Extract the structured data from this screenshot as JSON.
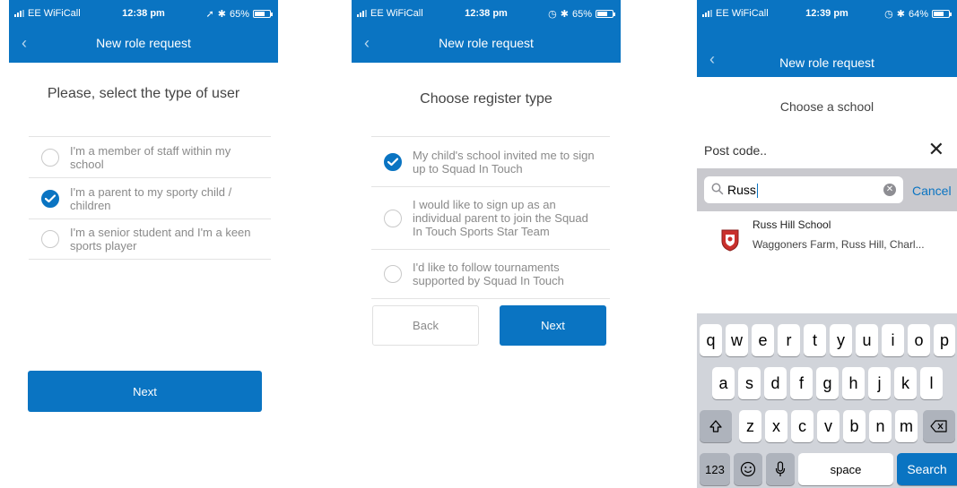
{
  "colors": {
    "primary": "#0a74c2",
    "keyboard_bg": "#d1d4da",
    "search_bar_bg": "#c9c9ce"
  },
  "phone1": {
    "status": {
      "carrier": "EE WiFiCall",
      "time": "12:38 pm",
      "battery": "65%"
    },
    "nav_title": "New role request",
    "heading": "Please, select the type of user",
    "options": [
      {
        "label": "I'm a member of staff within my school",
        "checked": false
      },
      {
        "label": "I'm a parent to my sporty child / children",
        "checked": true
      },
      {
        "label": "I'm a senior student and I'm a keen sports player",
        "checked": false
      }
    ],
    "next_label": "Next"
  },
  "phone2": {
    "status": {
      "carrier": "EE WiFiCall",
      "time": "12:38 pm",
      "battery": "65%"
    },
    "nav_title": "New role request",
    "heading": "Choose register type",
    "options": [
      {
        "label": "My child's school invited me to sign up to Squad In Touch",
        "checked": true
      },
      {
        "label": "I would like to sign up as an individual parent to join the Squad In Touch Sports Star Team",
        "checked": false
      },
      {
        "label": "I'd like to follow tournaments supported by Squad In Touch",
        "checked": false
      }
    ],
    "back_label": "Back",
    "next_label": "Next"
  },
  "phone3": {
    "status": {
      "carrier": "EE WiFiCall",
      "time": "12:39 pm",
      "battery": "64%"
    },
    "nav_title": "New role request",
    "heading": "Choose a school",
    "post_code_label": "Post code..",
    "search_value": "Russ",
    "cancel_label": "Cancel",
    "result": {
      "name": "Russ Hill School",
      "address": "Waggoners Farm, Russ Hill, Charl..."
    },
    "keyboard": {
      "row1": [
        "q",
        "w",
        "e",
        "r",
        "t",
        "y",
        "u",
        "i",
        "o",
        "p"
      ],
      "row2": [
        "a",
        "s",
        "d",
        "f",
        "g",
        "h",
        "j",
        "k",
        "l"
      ],
      "row3": [
        "z",
        "x",
        "c",
        "v",
        "b",
        "n",
        "m"
      ],
      "num_label": "123",
      "space_label": "space",
      "search_label": "Search"
    }
  }
}
